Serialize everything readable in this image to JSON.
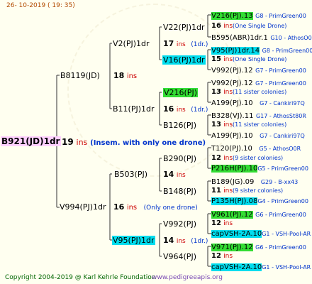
{
  "header": {
    "date": "26- 10-2019 ( 19: 35)"
  },
  "root": {
    "name": "B921(JD)1dr",
    "ins_num": "19",
    "ins_word": "ins",
    "note": "(Insem. with only one drone)"
  },
  "gen1": [
    {
      "name": "B8119(JD)",
      "ins_num": "18",
      "ins_word": "ins",
      "note": ""
    },
    {
      "name": "V994(PJ)1dr",
      "ins_num": "16",
      "ins_word": "ins",
      "note": "(Only one drone)"
    }
  ],
  "gen2": [
    {
      "name": "V2(PJ)1dr",
      "ins_num": "17",
      "ins_word": "ins",
      "note": "(1dr.)"
    },
    {
      "name": "B11(PJ)1dr",
      "ins_num": "16",
      "ins_word": "ins",
      "note": "(1dr.)"
    },
    {
      "name": "B503(PJ)",
      "ins_num": "14",
      "ins_word": "ins",
      "note": ""
    },
    {
      "name": "V95(PJ)1dr",
      "ins_num": "14",
      "ins_word": "ins",
      "note": "(1dr.)"
    }
  ],
  "gen3": [
    {
      "name": "V22(PJ)1dr",
      "ins_num": "16",
      "ins_word": "ins",
      "note": "(One Single Drone)"
    },
    {
      "name": "V16(PJ)1dr",
      "ins_num": "15",
      "ins_word": "ins",
      "note": "(One Single Drone)"
    },
    {
      "name": "V216(PJ)",
      "ins_num": "13",
      "ins_word": "ins",
      "note": "(11 sister colonies)"
    },
    {
      "name": "B126(PJ)",
      "ins_num": "13",
      "ins_word": "ins",
      "note": "(11 sister colonies)"
    },
    {
      "name": "B290(PJ)",
      "ins_num": "12",
      "ins_word": "ins",
      "note": "(9 sister colonies)"
    },
    {
      "name": "B148(PJ)",
      "ins_num": "11",
      "ins_word": "ins",
      "note": "(9 sister colonies)"
    },
    {
      "name": "V992(PJ)",
      "ins_num": "12",
      "ins_word": "ins",
      "note": ""
    },
    {
      "name": "V964(PJ)",
      "ins_num": "12",
      "ins_word": "ins",
      "note": ""
    }
  ],
  "gen4": [
    {
      "left": "V216(PJ).13",
      "right": "G8 - PrimGreen00"
    },
    {
      "left": "B595(ABR)1dr.1",
      "right": "G10 - AthosO0R"
    },
    {
      "left": "V95(PJ)1dr.14",
      "right": "G8 - PrimGreen00"
    },
    {
      "left": "V992(PJ).12",
      "right": "G7 - PrimGreen00"
    },
    {
      "left": "V992(PJ).12",
      "right": "G7 - PrimGreen00"
    },
    {
      "left": "A199(PJ).10",
      "right": "G7 - Cankiri97Q"
    },
    {
      "left": "B328(VJ).11",
      "right": "G17 - AthosSt80R"
    },
    {
      "left": "A199(PJ).10",
      "right": "G7 - Cankiri97Q"
    },
    {
      "left": "T120(PJ).10",
      "right": "G5 - AthosO0R"
    },
    {
      "left": "P216H(PJ).10",
      "right": "G5 - PrimGreen00"
    },
    {
      "left": "B189(JG).09",
      "right": "G29 - B-xx43"
    },
    {
      "left": "P135H(PJ).08",
      "right": "G4 - PrimGreen00"
    },
    {
      "left": "V961(PJ).12",
      "right": "G6 - PrimGreen00"
    },
    {
      "left": "capVSH-2A.10",
      "right": "G1 - VSH-Pool-AR"
    },
    {
      "left": "V971(PJ).12",
      "right": "G6 - PrimGreen00"
    },
    {
      "left": "capVSH-2A.10",
      "right": "G1 - VSH-Pool-AR"
    }
  ],
  "footer": {
    "copyright": "Copyright 2004-2019 @ Karl Kehrle Foundation",
    "url": "www.pedigreeapis.org"
  },
  "colors": {
    "background": "#fffff0",
    "root_bg": "#ffd0ff",
    "green": "#33dd33",
    "cyan": "#00ddee",
    "ins": "#cc0000",
    "note": "#0033cc"
  }
}
